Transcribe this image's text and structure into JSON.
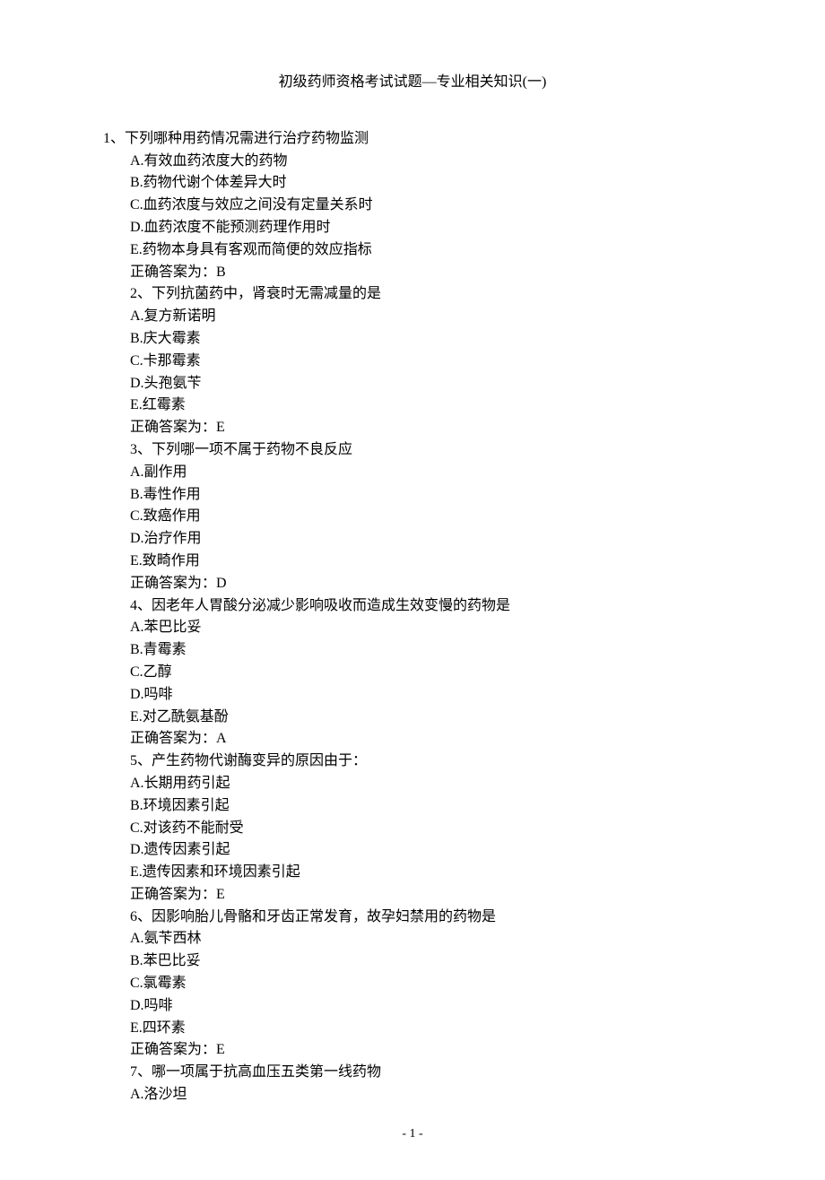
{
  "title": "初级药师资格考试试题—专业相关知识(一)",
  "questions": [
    {
      "number": "1、",
      "text": "下列哪种用药情况需进行治疗药物监测",
      "options": [
        "A.有效血药浓度大的药物",
        "B.药物代谢个体差异大时",
        "C.血药浓度与效应之间没有定量关系时",
        "D.血药浓度不能预测药理作用时",
        "E.药物本身具有客观而简便的效应指标"
      ],
      "answer": "正确答案为：B"
    },
    {
      "number": "2、",
      "text": "下列抗菌药中，肾衰时无需减量的是",
      "options": [
        "A.复方新诺明",
        "B.庆大霉素",
        "C.卡那霉素",
        "D.头孢氨苄",
        "E.红霉素"
      ],
      "answer": "正确答案为：E"
    },
    {
      "number": "3、",
      "text": "下列哪一项不属于药物不良反应",
      "options": [
        "A.副作用",
        "B.毒性作用",
        "C.致癌作用",
        "D.治疗作用",
        "E.致畸作用"
      ],
      "answer": "正确答案为：D"
    },
    {
      "number": "4、",
      "text": "因老年人胃酸分泌减少影响吸收而造成生效变慢的药物是",
      "options": [
        "A.苯巴比妥",
        "B.青霉素",
        "C.乙醇",
        "D.吗啡",
        "E.对乙酰氨基酚"
      ],
      "answer": "正确答案为：A"
    },
    {
      "number": "5、",
      "text": "产生药物代谢酶变异的原因由于：",
      "options": [
        "A.长期用药引起",
        "B.环境因素引起",
        "C.对该药不能耐受",
        "D.遗传因素引起",
        "E.遗传因素和环境因素引起"
      ],
      "answer": "正确答案为：E"
    },
    {
      "number": "6、",
      "text": "因影响胎儿骨骼和牙齿正常发育，故孕妇禁用的药物是",
      "options": [
        "A.氨苄西林",
        "B.苯巴比妥",
        "C.氯霉素",
        "D.吗啡",
        "E.四环素"
      ],
      "answer": "正确答案为：E"
    },
    {
      "number": "7、",
      "text": "哪一项属于抗高血压五类第一线药物",
      "options": [
        "A.洛沙坦"
      ],
      "answer": null
    }
  ],
  "pageNumber": "- 1 -"
}
